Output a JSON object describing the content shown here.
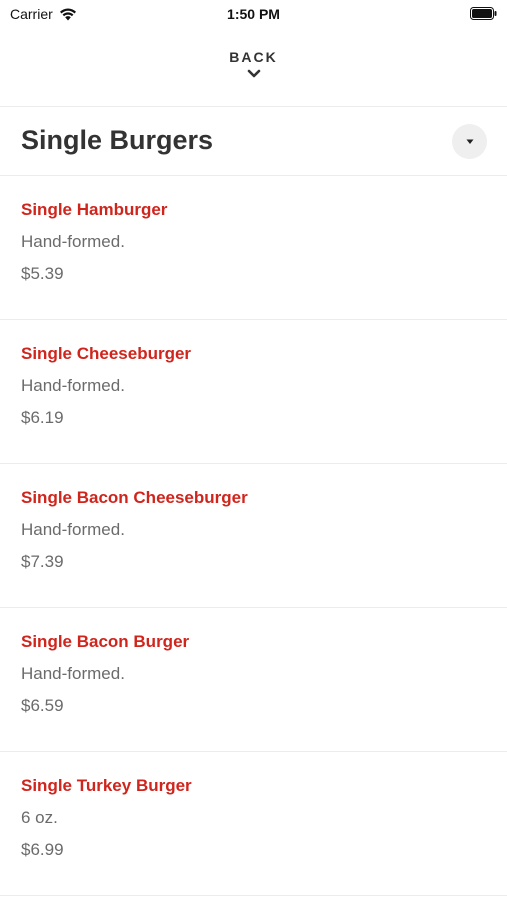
{
  "status_bar": {
    "carrier": "Carrier",
    "time": "1:50 PM"
  },
  "nav": {
    "back_label": "BACK"
  },
  "section": {
    "title": "Single Burgers"
  },
  "menu_items": [
    {
      "name": "Single Hamburger",
      "description": "Hand-formed.",
      "price": "$5.39"
    },
    {
      "name": "Single Cheeseburger",
      "description": "Hand-formed.",
      "price": "$6.19"
    },
    {
      "name": "Single Bacon Cheeseburger",
      "description": "Hand-formed.",
      "price": "$7.39"
    },
    {
      "name": "Single Bacon Burger",
      "description": "Hand-formed.",
      "price": "$6.59"
    },
    {
      "name": "Single Turkey Burger",
      "description": "6 oz.",
      "price": "$6.99"
    }
  ],
  "colors": {
    "item_name": "#d0251d",
    "body_text": "#6b6b6b",
    "title_text": "#333333"
  }
}
